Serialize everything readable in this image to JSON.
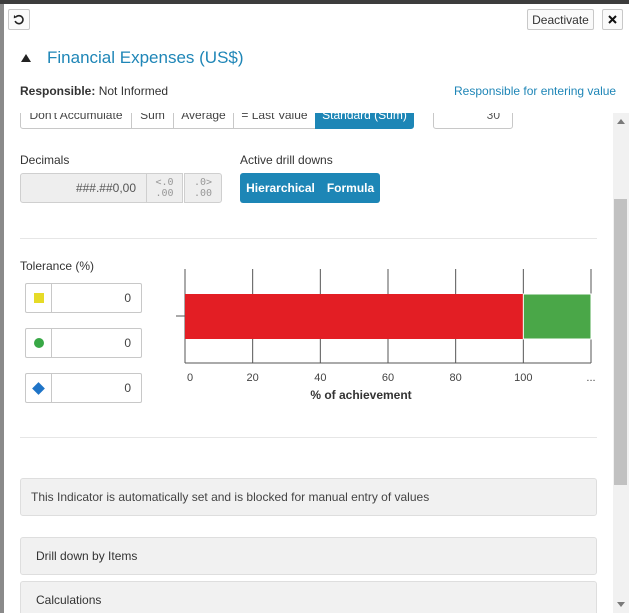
{
  "toolbar": {
    "deactivate_label": "Deactivate",
    "undo_icon": "undo-icon",
    "close_icon": "close-icon"
  },
  "header": {
    "title": "Financial Expenses (US$)",
    "responsible_label": "Responsible:",
    "responsible_value": "Not Informed",
    "responsible_link": "Responsible for entering value"
  },
  "accumulate": {
    "options": [
      "Don't Accumulate",
      "Sum",
      "Average",
      "= Last Value",
      "Standard (Sum)"
    ],
    "selected": "Standard (Sum)",
    "number_value": "30"
  },
  "decimals": {
    "label": "Decimals",
    "value": "###.##0,00",
    "decrease_icon": "decrease-decimals-icon",
    "increase_icon": "increase-decimals-icon"
  },
  "drill_downs": {
    "label": "Active drill downs",
    "options": [
      "Hierarchical",
      "Formula"
    ]
  },
  "tolerance": {
    "label": "Tolerance (%)",
    "rows": [
      {
        "icon": "yellow-square-icon",
        "value": "0"
      },
      {
        "icon": "green-circle-icon",
        "value": "0"
      },
      {
        "icon": "blue-diamond-icon",
        "value": "0"
      }
    ]
  },
  "chart_data": {
    "type": "bar",
    "orientation": "horizontal-stacked",
    "xlabel": "% of achievement",
    "tick_labels": [
      "0",
      "20",
      "40",
      "60",
      "80",
      "100",
      "..."
    ],
    "xlim": [
      0,
      120
    ],
    "segments": [
      {
        "from": 0,
        "to": 100,
        "color": "#e31e24"
      },
      {
        "from": 100,
        "to": 120,
        "color": "#4aa748"
      }
    ]
  },
  "info": {
    "message": "This Indicator is automatically set and is blocked for manual entry of values"
  },
  "sections": {
    "drill_down_items": "Drill down by Items",
    "calculations": "Calculations"
  }
}
